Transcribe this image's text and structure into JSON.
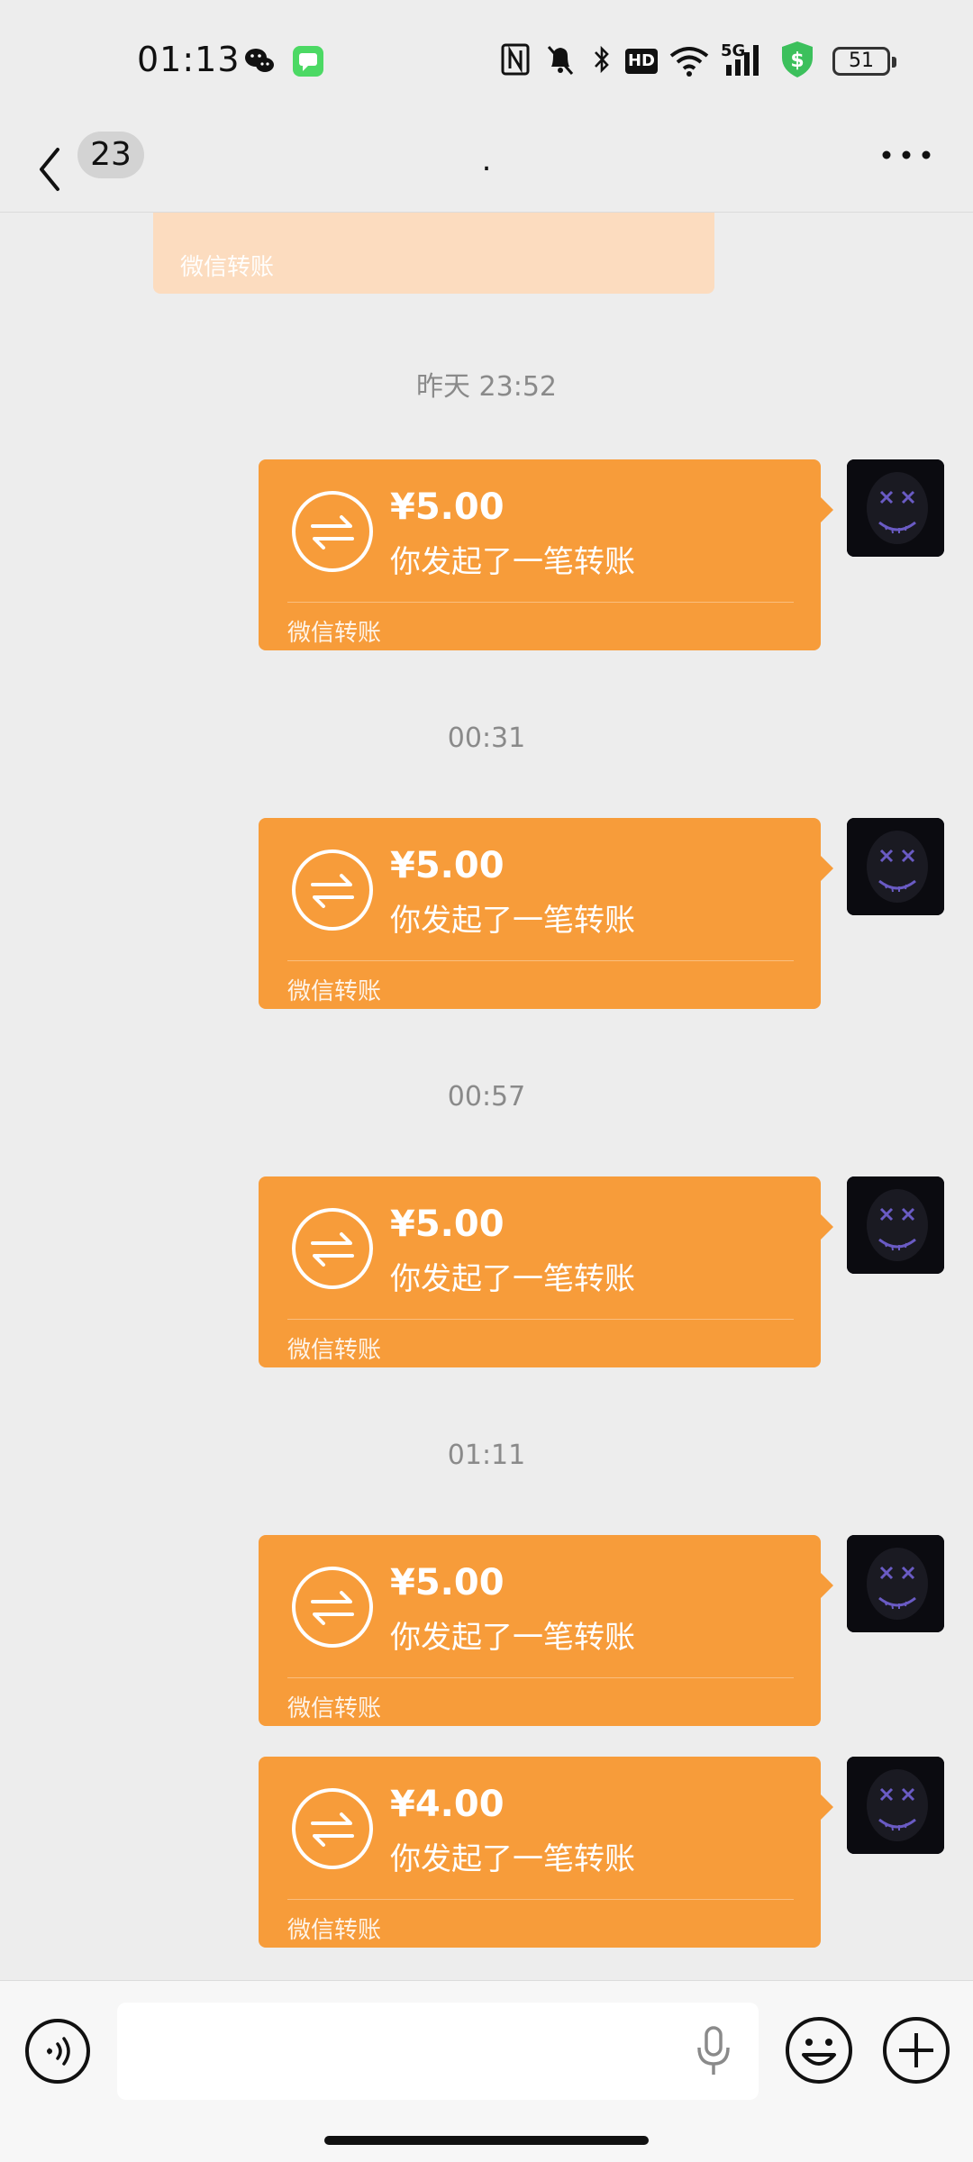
{
  "status_bar": {
    "time": "01:13",
    "network_label": "5G",
    "hd_label": "HD",
    "battery": "51",
    "icons": [
      "wechat-icon",
      "messages-icon",
      "nfc-icon",
      "mute-icon",
      "bluetooth-icon",
      "hd-icon",
      "wifi-icon",
      "signal-icon",
      "payment-shield-icon",
      "battery-icon"
    ]
  },
  "header": {
    "unread_count": "23",
    "title": ".",
    "icons": [
      "chevron-left-icon",
      "more-dots-icon"
    ]
  },
  "chat": {
    "partial_top": {
      "label": "微信转账"
    },
    "groups": [
      {
        "timestamp": "昨天 23:52",
        "messages": [
          {
            "amount": "¥5.00",
            "desc": "你发起了一笔转账",
            "footer": "微信转账"
          }
        ]
      },
      {
        "timestamp": "00:31",
        "messages": [
          {
            "amount": "¥5.00",
            "desc": "你发起了一笔转账",
            "footer": "微信转账"
          }
        ]
      },
      {
        "timestamp": "00:57",
        "messages": [
          {
            "amount": "¥5.00",
            "desc": "你发起了一笔转账",
            "footer": "微信转账"
          }
        ]
      },
      {
        "timestamp": "01:11",
        "messages": [
          {
            "amount": "¥5.00",
            "desc": "你发起了一笔转账",
            "footer": "微信转账"
          },
          {
            "amount": "¥4.00",
            "desc": "你发起了一笔转账",
            "footer": "微信转账"
          }
        ]
      }
    ]
  },
  "input_bar": {
    "icons": [
      "voice-icon",
      "mic-icon",
      "emoji-icon",
      "plus-icon"
    ]
  },
  "colors": {
    "background": "#ededed",
    "transfer_orange": "#f79c3a",
    "timestamp_gray": "#8a8a8a",
    "battery_safe_green": "#3cc05c"
  }
}
